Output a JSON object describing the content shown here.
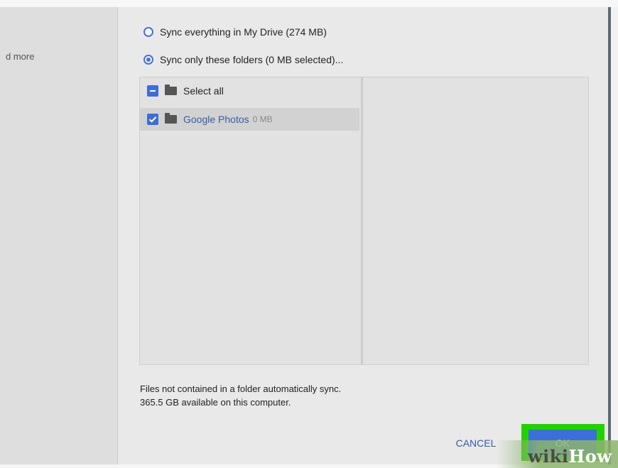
{
  "sidebar": {
    "partial_text": "d more"
  },
  "sync": {
    "option_all": "Sync everything in My Drive (274 MB)",
    "option_folders": "Sync only these folders (0 MB selected)..."
  },
  "tree": {
    "select_all_label": "Select all",
    "items": [
      {
        "name": "Google Photos",
        "size": "0 MB",
        "checked": true
      }
    ]
  },
  "footer": {
    "note_line1": "Files not contained in a folder automatically sync.",
    "note_line2": "365.5 GB available on this computer."
  },
  "buttons": {
    "cancel": "CANCEL",
    "ok": "OK"
  },
  "watermark": {
    "wiki": "wiki",
    "how": "How"
  },
  "colors": {
    "accent": "#3d6fd8",
    "highlight": "#23d100",
    "link": "#3a5ba8"
  }
}
